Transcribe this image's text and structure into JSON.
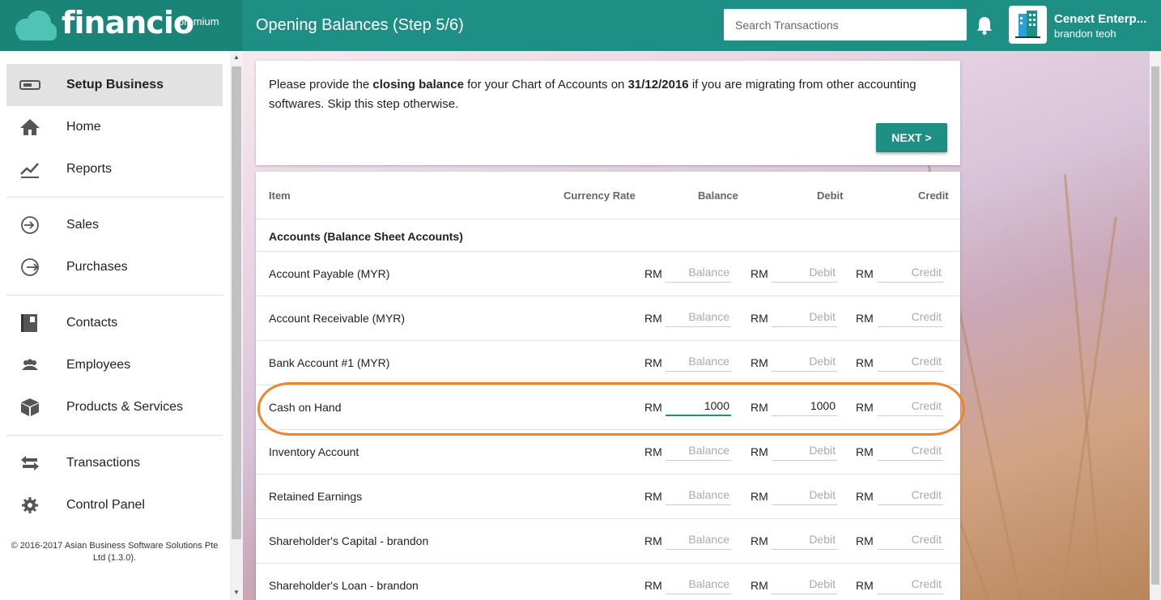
{
  "header": {
    "logo_text": "financio",
    "logo_badge": "premium",
    "page_title": "Opening Balances (Step 5/6)",
    "search_placeholder": "Search Transactions",
    "company_name": "Cenext Enterp...",
    "user_name": "brandon teoh"
  },
  "sidebar": {
    "items": [
      {
        "label": "Setup Business",
        "icon": "setup-icon"
      },
      {
        "label": "Home",
        "icon": "home-icon"
      },
      {
        "label": "Reports",
        "icon": "chart-trend-icon"
      },
      {
        "label": "Sales",
        "icon": "arrow-in-icon"
      },
      {
        "label": "Purchases",
        "icon": "arrow-out-icon"
      },
      {
        "label": "Contacts",
        "icon": "contacts-book-icon"
      },
      {
        "label": "Employees",
        "icon": "people-icon"
      },
      {
        "label": "Products & Services",
        "icon": "box-icon"
      },
      {
        "label": "Transactions",
        "icon": "swap-arrows-icon"
      },
      {
        "label": "Control Panel",
        "icon": "gear-icon"
      }
    ],
    "copyright": "© 2016-2017 Asian Business Software Solutions Pte Ltd (1.3.0)."
  },
  "intro": {
    "text_1": "Please provide the ",
    "bold_1": "closing balance",
    "text_2": " for your Chart of Accounts on ",
    "bold_2": "31/12/2016",
    "text_3": " if you are migrating from other accounting softwares. Skip this step otherwise.",
    "next_label": "NEXT >"
  },
  "table": {
    "headers": {
      "item": "Item",
      "currency_rate": "Currency Rate",
      "balance": "Balance",
      "debit": "Debit",
      "credit": "Credit"
    },
    "section_title": "Accounts (Balance Sheet Accounts)",
    "currency": "RM",
    "placeholders": {
      "balance": "Balance",
      "debit": "Debit",
      "credit": "Credit"
    },
    "rows": [
      {
        "name": "Account Payable (MYR)",
        "balance": "",
        "debit": "",
        "credit": ""
      },
      {
        "name": "Account Receivable (MYR)",
        "balance": "",
        "debit": "",
        "credit": ""
      },
      {
        "name": "Bank Account #1 (MYR)",
        "balance": "",
        "debit": "",
        "credit": ""
      },
      {
        "name": "Cash on Hand",
        "balance": "1000",
        "debit": "1000",
        "credit": ""
      },
      {
        "name": "Inventory Account",
        "balance": "",
        "debit": "",
        "credit": ""
      },
      {
        "name": "Retained Earnings",
        "balance": "",
        "debit": "",
        "credit": ""
      },
      {
        "name": "Shareholder's Capital - brandon",
        "balance": "",
        "debit": "",
        "credit": ""
      },
      {
        "name": "Shareholder's Loan - brandon",
        "balance": "",
        "debit": "",
        "credit": ""
      }
    ]
  },
  "colors": {
    "brand": "#1e8f84",
    "highlight": "#f0842a"
  }
}
